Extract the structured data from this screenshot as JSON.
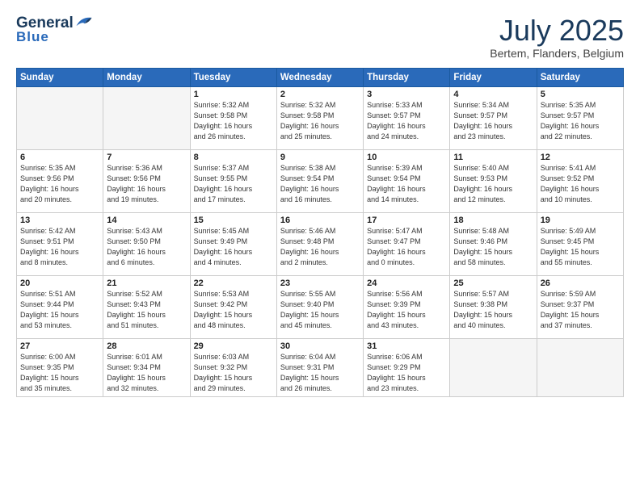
{
  "header": {
    "logo_line1": "General",
    "logo_line2": "Blue",
    "month": "July 2025",
    "location": "Bertem, Flanders, Belgium"
  },
  "weekdays": [
    "Sunday",
    "Monday",
    "Tuesday",
    "Wednesday",
    "Thursday",
    "Friday",
    "Saturday"
  ],
  "weeks": [
    [
      {
        "day": "",
        "detail": ""
      },
      {
        "day": "",
        "detail": ""
      },
      {
        "day": "1",
        "detail": "Sunrise: 5:32 AM\nSunset: 9:58 PM\nDaylight: 16 hours\nand 26 minutes."
      },
      {
        "day": "2",
        "detail": "Sunrise: 5:32 AM\nSunset: 9:58 PM\nDaylight: 16 hours\nand 25 minutes."
      },
      {
        "day": "3",
        "detail": "Sunrise: 5:33 AM\nSunset: 9:57 PM\nDaylight: 16 hours\nand 24 minutes."
      },
      {
        "day": "4",
        "detail": "Sunrise: 5:34 AM\nSunset: 9:57 PM\nDaylight: 16 hours\nand 23 minutes."
      },
      {
        "day": "5",
        "detail": "Sunrise: 5:35 AM\nSunset: 9:57 PM\nDaylight: 16 hours\nand 22 minutes."
      }
    ],
    [
      {
        "day": "6",
        "detail": "Sunrise: 5:35 AM\nSunset: 9:56 PM\nDaylight: 16 hours\nand 20 minutes."
      },
      {
        "day": "7",
        "detail": "Sunrise: 5:36 AM\nSunset: 9:56 PM\nDaylight: 16 hours\nand 19 minutes."
      },
      {
        "day": "8",
        "detail": "Sunrise: 5:37 AM\nSunset: 9:55 PM\nDaylight: 16 hours\nand 17 minutes."
      },
      {
        "day": "9",
        "detail": "Sunrise: 5:38 AM\nSunset: 9:54 PM\nDaylight: 16 hours\nand 16 minutes."
      },
      {
        "day": "10",
        "detail": "Sunrise: 5:39 AM\nSunset: 9:54 PM\nDaylight: 16 hours\nand 14 minutes."
      },
      {
        "day": "11",
        "detail": "Sunrise: 5:40 AM\nSunset: 9:53 PM\nDaylight: 16 hours\nand 12 minutes."
      },
      {
        "day": "12",
        "detail": "Sunrise: 5:41 AM\nSunset: 9:52 PM\nDaylight: 16 hours\nand 10 minutes."
      }
    ],
    [
      {
        "day": "13",
        "detail": "Sunrise: 5:42 AM\nSunset: 9:51 PM\nDaylight: 16 hours\nand 8 minutes."
      },
      {
        "day": "14",
        "detail": "Sunrise: 5:43 AM\nSunset: 9:50 PM\nDaylight: 16 hours\nand 6 minutes."
      },
      {
        "day": "15",
        "detail": "Sunrise: 5:45 AM\nSunset: 9:49 PM\nDaylight: 16 hours\nand 4 minutes."
      },
      {
        "day": "16",
        "detail": "Sunrise: 5:46 AM\nSunset: 9:48 PM\nDaylight: 16 hours\nand 2 minutes."
      },
      {
        "day": "17",
        "detail": "Sunrise: 5:47 AM\nSunset: 9:47 PM\nDaylight: 16 hours\nand 0 minutes."
      },
      {
        "day": "18",
        "detail": "Sunrise: 5:48 AM\nSunset: 9:46 PM\nDaylight: 15 hours\nand 58 minutes."
      },
      {
        "day": "19",
        "detail": "Sunrise: 5:49 AM\nSunset: 9:45 PM\nDaylight: 15 hours\nand 55 minutes."
      }
    ],
    [
      {
        "day": "20",
        "detail": "Sunrise: 5:51 AM\nSunset: 9:44 PM\nDaylight: 15 hours\nand 53 minutes."
      },
      {
        "day": "21",
        "detail": "Sunrise: 5:52 AM\nSunset: 9:43 PM\nDaylight: 15 hours\nand 51 minutes."
      },
      {
        "day": "22",
        "detail": "Sunrise: 5:53 AM\nSunset: 9:42 PM\nDaylight: 15 hours\nand 48 minutes."
      },
      {
        "day": "23",
        "detail": "Sunrise: 5:55 AM\nSunset: 9:40 PM\nDaylight: 15 hours\nand 45 minutes."
      },
      {
        "day": "24",
        "detail": "Sunrise: 5:56 AM\nSunset: 9:39 PM\nDaylight: 15 hours\nand 43 minutes."
      },
      {
        "day": "25",
        "detail": "Sunrise: 5:57 AM\nSunset: 9:38 PM\nDaylight: 15 hours\nand 40 minutes."
      },
      {
        "day": "26",
        "detail": "Sunrise: 5:59 AM\nSunset: 9:37 PM\nDaylight: 15 hours\nand 37 minutes."
      }
    ],
    [
      {
        "day": "27",
        "detail": "Sunrise: 6:00 AM\nSunset: 9:35 PM\nDaylight: 15 hours\nand 35 minutes."
      },
      {
        "day": "28",
        "detail": "Sunrise: 6:01 AM\nSunset: 9:34 PM\nDaylight: 15 hours\nand 32 minutes."
      },
      {
        "day": "29",
        "detail": "Sunrise: 6:03 AM\nSunset: 9:32 PM\nDaylight: 15 hours\nand 29 minutes."
      },
      {
        "day": "30",
        "detail": "Sunrise: 6:04 AM\nSunset: 9:31 PM\nDaylight: 15 hours\nand 26 minutes."
      },
      {
        "day": "31",
        "detail": "Sunrise: 6:06 AM\nSunset: 9:29 PM\nDaylight: 15 hours\nand 23 minutes."
      },
      {
        "day": "",
        "detail": ""
      },
      {
        "day": "",
        "detail": ""
      }
    ]
  ]
}
